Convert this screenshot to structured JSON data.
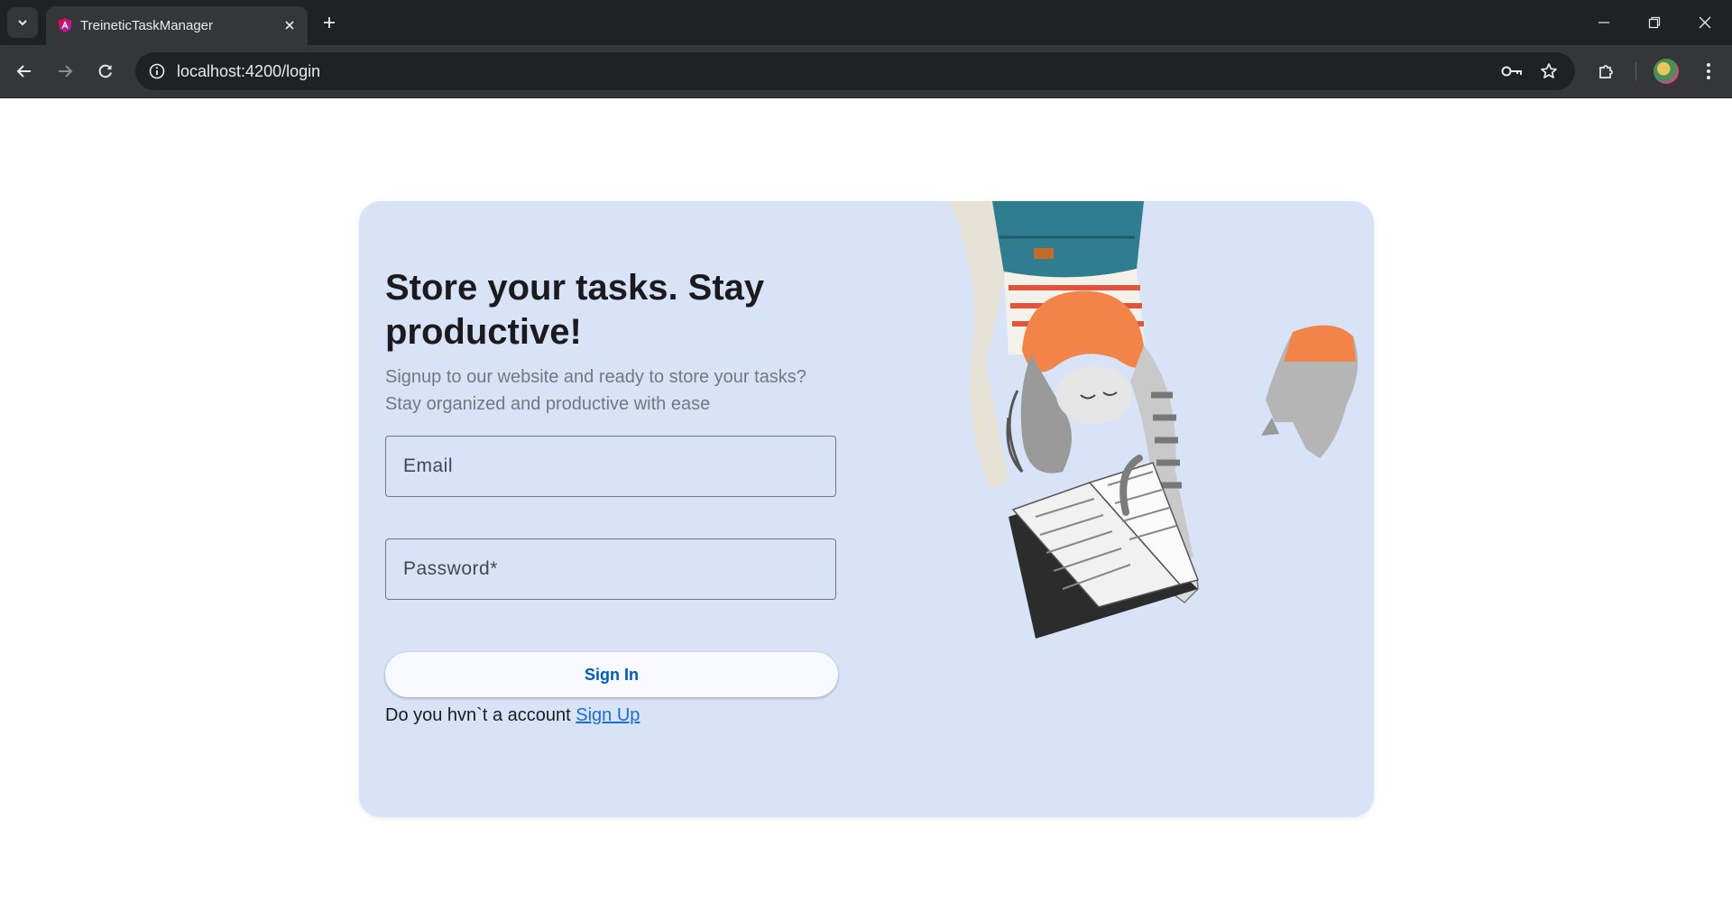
{
  "browser": {
    "tab_title": "TreineticTaskManager",
    "url": "localhost:4200/login",
    "icons": {
      "tab_list": "chevron-down-icon",
      "favicon": "angular-logo-icon",
      "tab_close": "close-icon",
      "new_tab": "plus-icon",
      "minimize": "minimize-icon",
      "restore": "restore-icon",
      "close_window": "close-icon",
      "back": "arrow-left-icon",
      "forward": "arrow-right-icon",
      "reload": "reload-icon",
      "site_info": "info-icon",
      "password": "key-icon",
      "bookmark": "star-icon",
      "extensions": "puzzle-icon",
      "menu": "kebab-icon"
    }
  },
  "login": {
    "headline": "Store your tasks. Stay productive!",
    "subtext": "Signup to our website and ready to store your tasks? Stay organized and productive with ease",
    "email_placeholder": "Email",
    "password_placeholder": "Password*",
    "signin_label": "Sign In",
    "signup_prompt": "Do you hvn`t a account",
    "signup_link": "Sign Up"
  },
  "colors": {
    "card_bg": "#d9e3f8",
    "primary": "#005cbb",
    "link": "#1a6fd1",
    "hair": "#f2844a",
    "stripe": "#e0553e",
    "jeans": "#2f7d8f"
  }
}
